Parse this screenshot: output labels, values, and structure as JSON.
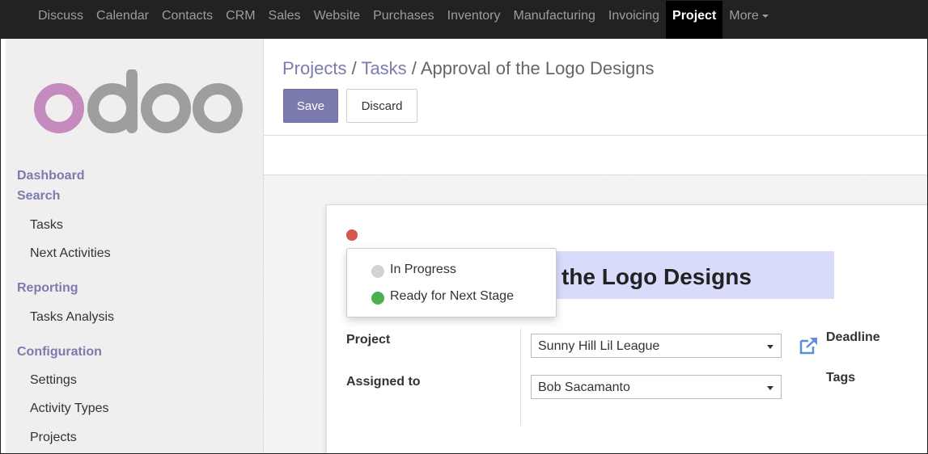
{
  "topnav": {
    "items": [
      "Discuss",
      "Calendar",
      "Contacts",
      "CRM",
      "Sales",
      "Website",
      "Purchases",
      "Inventory",
      "Manufacturing",
      "Invoicing",
      "Project",
      "More"
    ],
    "active": "Project"
  },
  "logo": {
    "text": "odoo"
  },
  "sidebar": {
    "dashboard": "Dashboard",
    "search": "Search",
    "tasks": "Tasks",
    "next_activities": "Next Activities",
    "reporting": "Reporting",
    "tasks_analysis": "Tasks Analysis",
    "configuration": "Configuration",
    "settings": "Settings",
    "activity_types": "Activity Types",
    "projects": "Projects"
  },
  "breadcrumb": {
    "projects": "Projects",
    "sep1": " / ",
    "tasks": "Tasks",
    "sep2": " / ",
    "current": "Approval of the Logo Designs"
  },
  "toolbar": {
    "save_label": "Save",
    "discard_label": "Discard"
  },
  "form": {
    "title_visible": "the Logo Designs",
    "status_menu": {
      "in_progress": "In Progress",
      "ready": "Ready for Next Stage"
    },
    "project_label": "Project",
    "project_value": "Sunny Hill Lil League",
    "assigned_label": "Assigned to",
    "assigned_value": "Bob Sacamanto",
    "deadline_label": "Deadline",
    "tags_label": "Tags"
  },
  "colors": {
    "topbar": "#222222",
    "accent": "#7c7bad",
    "status_red": "#d9534f",
    "status_green": "#4caf50",
    "status_grey": "#d3d3d3",
    "title_highlight": "#d9dbfb",
    "logo_pink": "#c58bbd",
    "logo_grey": "#9e9e9e"
  }
}
